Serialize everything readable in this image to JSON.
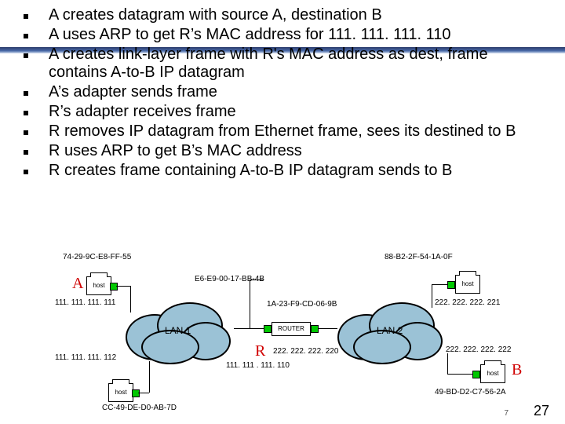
{
  "bullets": [
    "A creates datagram with source A, destination B",
    "A uses ARP to get R’s MAC address for 111. 111. 111. 110",
    "A creates link-layer frame with R's MAC address as dest, frame contains A-to-B IP datagram",
    "A’s adapter sends frame",
    "R’s adapter receives frame",
    "R removes IP datagram from Ethernet frame, sees its destined to B",
    "R uses ARP to get B’s MAC address",
    "R creates frame containing A-to-B IP datagram sends to B"
  ],
  "diagram": {
    "node_A": {
      "label": "A",
      "ip": "111. 111. 111. 111",
      "mac": "74-29-9C-E8-FF-55"
    },
    "node_A2": {
      "ip": "111. 111. 111. 112",
      "mac": "CC-49-DE-D0-AB-7D"
    },
    "router": {
      "label": "R",
      "name": "ROUTER",
      "left_ip": "111. 111 . 111. 110",
      "left_mac": "E6-E9-00-17-BB-4B",
      "right_ip": "222. 222. 222. 220",
      "right_mac": "1A-23-F9-CD-06-9B"
    },
    "node_B1": {
      "ip": "222. 222. 222. 221",
      "mac": "88-B2-2F-54-1A-0F"
    },
    "node_B": {
      "label": "B",
      "ip": "222. 222. 222. 222",
      "mac": "49-BD-D2-C7-56-2A"
    },
    "lan1": "LAN 1",
    "lan2": "LAN 2",
    "host_label": "host"
  },
  "page_number_small": "7",
  "page_number": "27"
}
